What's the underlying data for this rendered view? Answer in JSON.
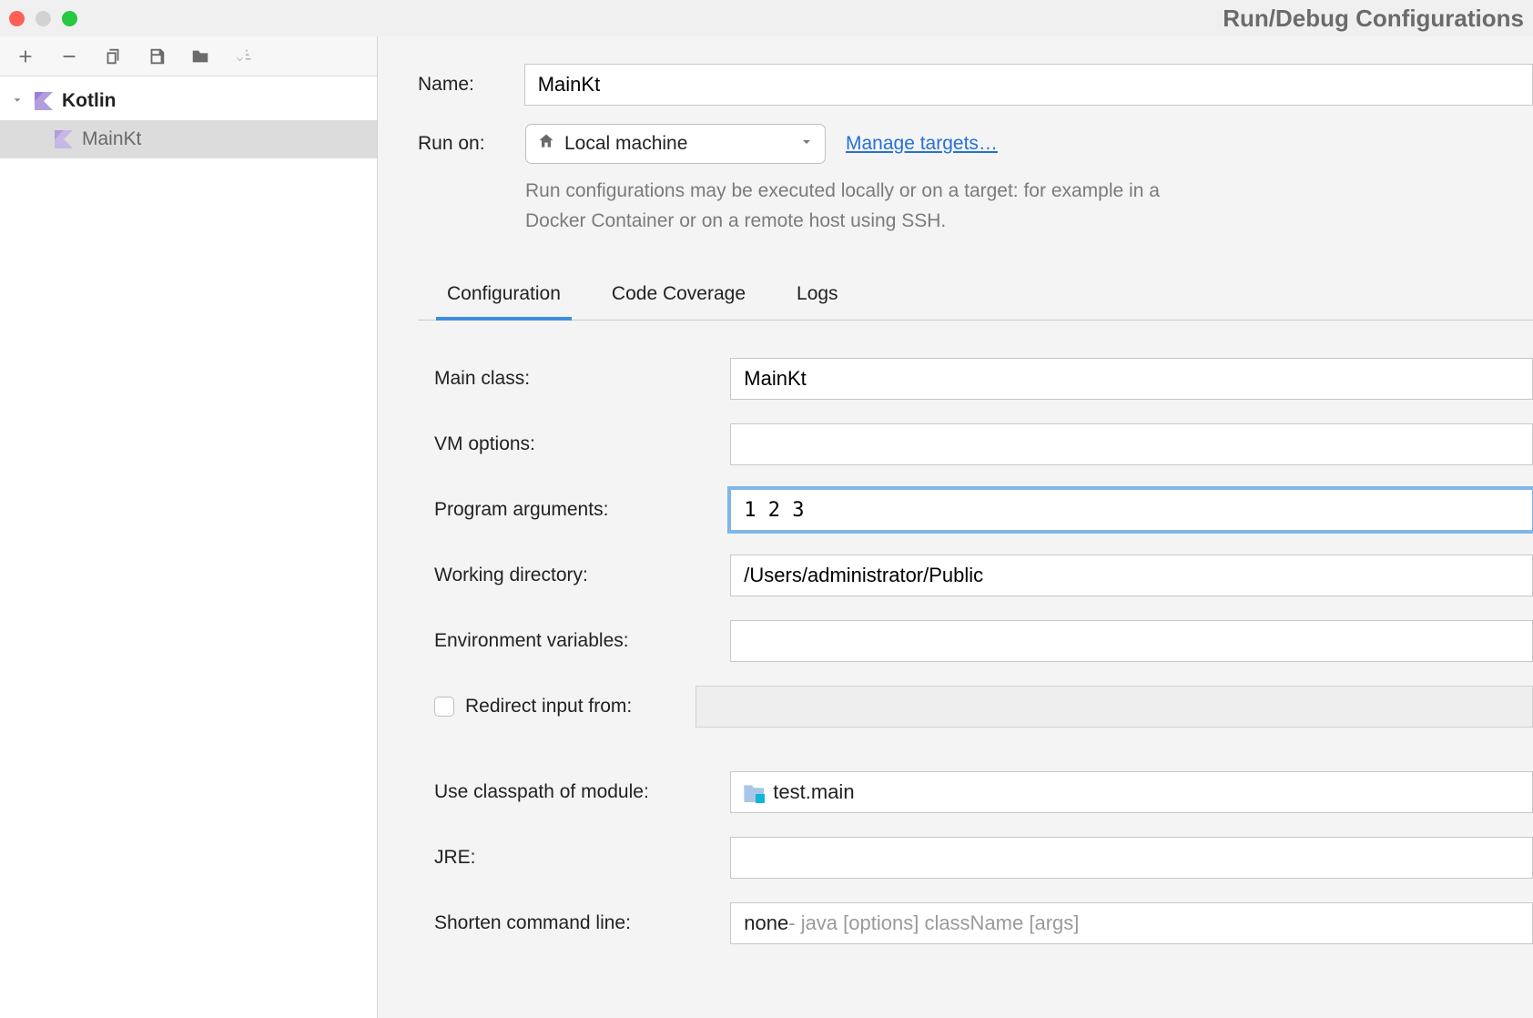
{
  "window": {
    "title": "Run/Debug Configurations"
  },
  "sidebar": {
    "group_label": "Kotlin",
    "items": [
      {
        "label": "MainKt"
      }
    ]
  },
  "header": {
    "name_label": "Name:",
    "name_value": "MainKt",
    "runon_label": "Run on:",
    "runon_value": "Local machine",
    "manage_targets_label": "Manage targets…",
    "hint": "Run configurations may be executed locally or on a target: for example in a Docker Container or on a remote host using SSH."
  },
  "tabs": [
    {
      "label": "Configuration",
      "active": true
    },
    {
      "label": "Code Coverage"
    },
    {
      "label": "Logs"
    }
  ],
  "form": {
    "main_class_label": "Main class:",
    "main_class_value": "MainKt",
    "vm_options_label": "VM options:",
    "vm_options_value": "",
    "program_args_label": "Program arguments:",
    "program_args_value": "1 2 3",
    "working_dir_label": "Working directory:",
    "working_dir_value": "/Users/administrator/Public",
    "env_vars_label": "Environment variables:",
    "env_vars_value": "",
    "redirect_label": "Redirect input from:",
    "redirect_value": "",
    "classpath_label": "Use classpath of module:",
    "classpath_value": "test.main",
    "jre_label": "JRE:",
    "jre_value": "",
    "shorten_label": "Shorten command line:",
    "shorten_value": "none",
    "shorten_suffix": " - java [options] className [args]"
  }
}
